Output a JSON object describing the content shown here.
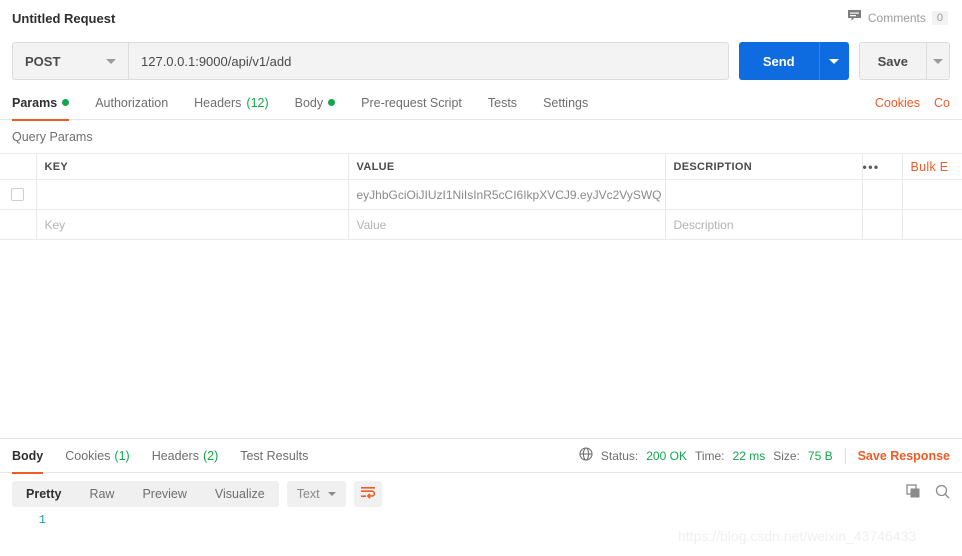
{
  "header": {
    "request_title": "Untitled Request",
    "comments_icon": "comment-bubble-icon",
    "comments_label": "Comments",
    "comments_count": "0"
  },
  "url_bar": {
    "method": "POST",
    "url": "127.0.0.1:9000/api/v1/add",
    "send_label": "Send",
    "save_label": "Save"
  },
  "request_tabs": [
    {
      "label": "Params",
      "indicator": "dot",
      "active": true
    },
    {
      "label": "Authorization",
      "indicator": "",
      "active": false
    },
    {
      "label": "Headers",
      "count": "(12)",
      "active": false
    },
    {
      "label": "Body",
      "indicator": "dot",
      "active": false
    },
    {
      "label": "Pre-request Script",
      "indicator": "",
      "active": false
    },
    {
      "label": "Tests",
      "indicator": "",
      "active": false
    },
    {
      "label": "Settings",
      "indicator": "",
      "active": false
    }
  ],
  "request_tabs_right": {
    "cookies": "Cookies",
    "code": "Co"
  },
  "query_params": {
    "section_title": "Query Params",
    "columns": {
      "key": "KEY",
      "value": "VALUE",
      "description": "DESCRIPTION",
      "actions": "•••",
      "bulk_edit": "Bulk E"
    },
    "rows": [
      {
        "checked": false,
        "key": "",
        "value": "eyJhbGciOiJIUzI1NiIsInR5cCI6IkpXVCJ9.eyJVc2VySWQ ...",
        "description": "",
        "is_placeholder_row": false
      },
      {
        "key": "Key",
        "value": "Value",
        "description": "Description",
        "is_placeholder_row": true
      }
    ]
  },
  "response": {
    "tabs": [
      {
        "label": "Body",
        "count": "",
        "active": true
      },
      {
        "label": "Cookies",
        "count": "(1)",
        "active": false
      },
      {
        "label": "Headers",
        "count": "(2)",
        "active": false
      },
      {
        "label": "Test Results",
        "count": "",
        "active": false
      }
    ],
    "globe_icon": "globe-icon",
    "status_label": "Status:",
    "status_value": "200 OK",
    "time_label": "Time:",
    "time_value": "22 ms",
    "size_label": "Size:",
    "size_value": "75 B",
    "save_response": "Save Response",
    "viewer": {
      "modes": [
        "Pretty",
        "Raw",
        "Preview",
        "Visualize"
      ],
      "active_mode": "Pretty",
      "format": "Text",
      "wrap_icon": "word-wrap-icon",
      "copy_icon": "copy-icon",
      "search_icon": "search-icon"
    },
    "body_lines": [
      {
        "number": "1",
        "text": ""
      }
    ]
  },
  "watermark": "https://blog.csdn.net/weixin_43746433",
  "colors": {
    "accent_orange": "#ef5b25",
    "send_blue": "#0f6ce0",
    "status_green": "#11a84b",
    "line_number_teal": "#1a9f9f"
  }
}
